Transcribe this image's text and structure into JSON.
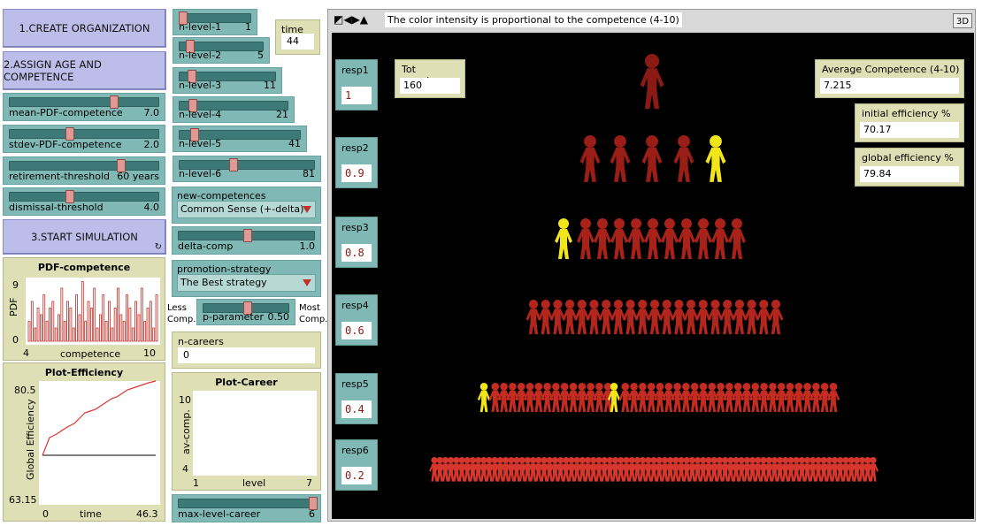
{
  "buttons": {
    "create": "1.CREATE ORGANIZATION",
    "assign": "2.ASSIGN AGE AND COMPETENCE",
    "start": "3.START SIMULATION",
    "start_icon": "forever-icon"
  },
  "sliders_left": [
    {
      "label": "mean-PDF-competence",
      "value": "7.0",
      "level": 0.5
    },
    {
      "label": "stdev-PDF-competence",
      "value": "2.0",
      "level": 0.4
    },
    {
      "label": "retirement-threshold",
      "value": "60 years",
      "level": 0.75
    },
    {
      "label": "dismissal-threshold",
      "value": "4.0",
      "level": 0.4
    }
  ],
  "sliders_levels": [
    {
      "label": "n-level-1",
      "value": "1",
      "level": 0.0
    },
    {
      "label": "n-level-2",
      "value": "5",
      "level": 0.1
    },
    {
      "label": "n-level-3",
      "value": "11",
      "level": 0.1
    },
    {
      "label": "n-level-4",
      "value": "21",
      "level": 0.1
    },
    {
      "label": "n-level-5",
      "value": "41",
      "level": 0.1
    },
    {
      "label": "n-level-6",
      "value": "81",
      "level": 0.4
    }
  ],
  "time": {
    "label": "time",
    "value": "44"
  },
  "new_competences": {
    "label": "new-competences",
    "selected": "Common Sense (+-delta)"
  },
  "delta_comp": {
    "label": "delta-comp",
    "value": "1.0",
    "level": 0.5
  },
  "promotion_strategy": {
    "label": "promotion-strategy",
    "selected": "The Best strategy"
  },
  "p_parameter": {
    "label": "p-parameter",
    "value": "0.50",
    "left_label_1": "Less",
    "left_label_2": "Comp.",
    "right_label_1": "Most",
    "right_label_2": "Comp.",
    "level": 0.5
  },
  "n_careers": {
    "label": "n-careers",
    "value": "0"
  },
  "max_level_career": {
    "label": "max-level-career",
    "value": "6",
    "level": 1.0
  },
  "pdf_plot": {
    "title": "PDF-competence",
    "ylabel": "PDF",
    "xlabel": "competence",
    "ymax": "9",
    "ymin": "0",
    "xmin": "4",
    "xmax": "10"
  },
  "eff_plot": {
    "title": "Plot-Efficiency",
    "ylabel": "Global Efficiency",
    "xlabel": "time",
    "ymax": "80.5",
    "ymin": "63.15",
    "xmin": "0",
    "xmax": "46.3"
  },
  "career_plot": {
    "title": "Plot-Career",
    "ylabel": "av-comp.",
    "xlabel": "level",
    "ymax": "10",
    "ymin": "4",
    "xmin": "1",
    "xmax": "7"
  },
  "world": {
    "title": "The color intensity is proportional to the competence (4-10)",
    "btn_3d": "3D"
  },
  "resp": [
    {
      "label": "resp1",
      "value": "1"
    },
    {
      "label": "resp2",
      "value": "0.9"
    },
    {
      "label": "resp3",
      "value": "0.8"
    },
    {
      "label": "resp4",
      "value": "0.6"
    },
    {
      "label": "resp5",
      "value": "0.4"
    },
    {
      "label": "resp6",
      "value": "0.2"
    }
  ],
  "tot_members": {
    "label": "Tot members",
    "value": "160"
  },
  "avg_comp": {
    "label": "Average Competence (4-10)",
    "value": "7.215"
  },
  "init_eff": {
    "label": "initial efficiency %",
    "value": "70.17"
  },
  "glob_eff": {
    "label": "global efficiency %",
    "value": "79.84"
  },
  "colors": {
    "person_dark": "#8b1a14",
    "person_light": "#e0332b",
    "highlight": "#f2e61a",
    "world_bg": "#000000"
  }
}
